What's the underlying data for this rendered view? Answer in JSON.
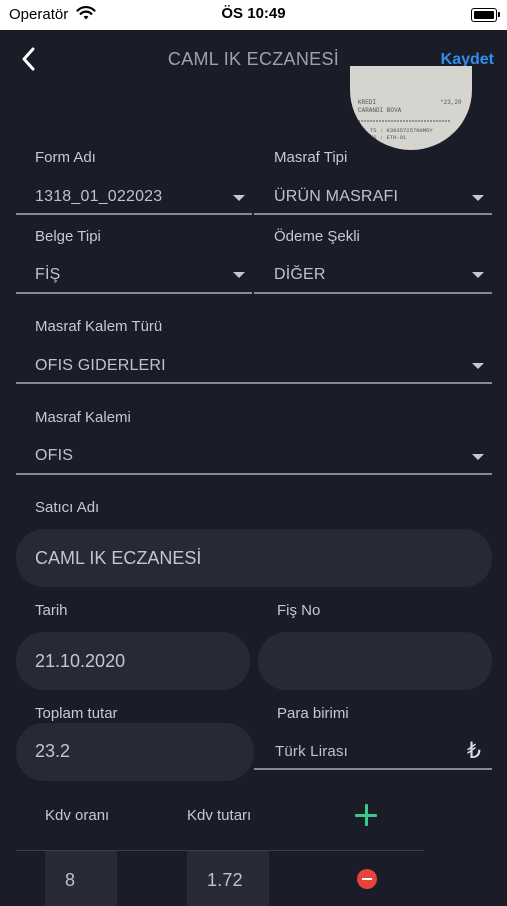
{
  "status_bar": {
    "carrier": "Operatör",
    "time": "ÖS 10:49"
  },
  "nav": {
    "title": "CAML IK ECZANESİ",
    "save_label": "Kaydet",
    "back_icon": "chevron-left-icon"
  },
  "receipt_image": {
    "lines": [
      "KREDİ",
      "CARANDI BOVA",
      "*23,20",
      "TS : K38357257N0MDY",
      "TS : ETH-01"
    ]
  },
  "form": {
    "form_name": {
      "label": "Form Adı",
      "value": "1318_01_022023"
    },
    "expense_type": {
      "label": "Masraf Tipi",
      "value": "ÜRÜN MASRAFI"
    },
    "document_type": {
      "label": "Belge Tipi",
      "value": "FİŞ"
    },
    "payment_method": {
      "label": "Ödeme Şekli",
      "value": "DİĞER"
    },
    "expense_item_type": {
      "label": "Masraf Kalem Türü",
      "value": "OFIS GIDERLERI"
    },
    "expense_item": {
      "label": "Masraf Kalemi",
      "value": "OFIS"
    },
    "vendor": {
      "label": "Satıcı Adı",
      "value": "CAML IK ECZANESİ"
    },
    "date": {
      "label": "Tarih",
      "value": "21.10.2020"
    },
    "receipt_no": {
      "label": "Fiş No",
      "value": ""
    },
    "total": {
      "label": "Toplam tutar",
      "value": "23.2"
    },
    "currency": {
      "label": "Para birimi",
      "value": "Türk Lirası",
      "symbol": "₺"
    }
  },
  "kdv": {
    "rate_label": "Kdv oranı",
    "amount_label": "Kdv tutarı",
    "rows": [
      {
        "rate": "8",
        "amount": "1.72"
      }
    ]
  },
  "colors": {
    "background": "#1a1c27",
    "accent": "#2e8ff0",
    "add": "#3cc98c",
    "remove": "#e8423d"
  }
}
